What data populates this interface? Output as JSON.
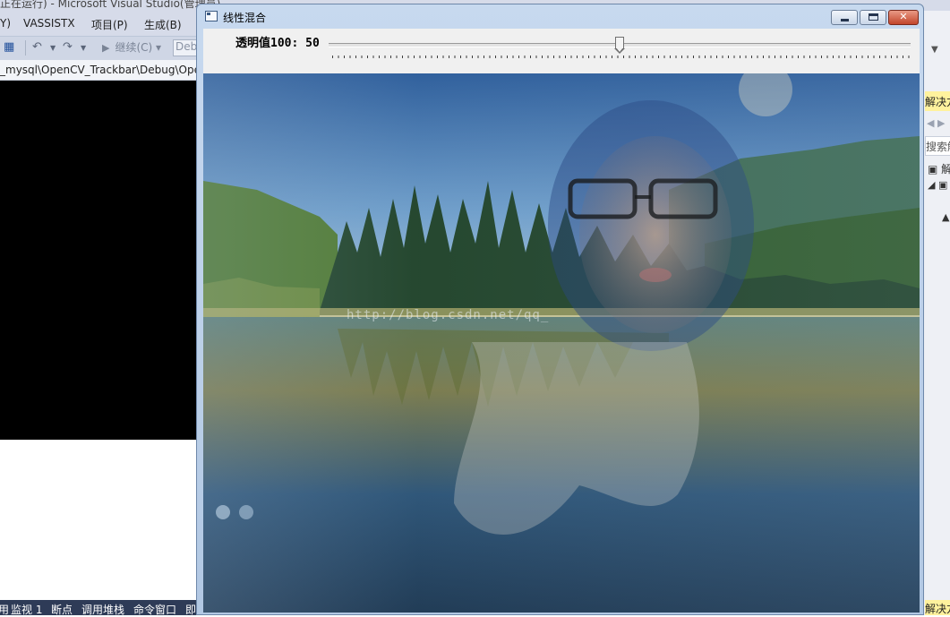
{
  "vs": {
    "title": "正在运行) - Microsoft Visual Studio(管理员)",
    "menu": [
      {
        "label": "Y)"
      },
      {
        "label": "VASSISTX"
      },
      {
        "label": "项目(P)"
      },
      {
        "label": "生成(B)"
      }
    ],
    "toolbar": {
      "continue_label": "继续(C)",
      "config_label": "Debug"
    },
    "path": "_mysql\\OpenCV_Trackbar\\Debug\\OpenCV_Trackbar.exe",
    "status_tabs": [
      "调用",
      "监视 1",
      "断点",
      "调用堆栈",
      "命令窗口",
      "即时窗口"
    ],
    "solution_explorer": {
      "header": "解决方案资源管理器",
      "search_placeholder": "搜索解决方案资源管理器",
      "footer": "解决方案资源管理器"
    },
    "icons": {
      "save": "save-icon",
      "undo": "undo-icon",
      "redo": "redo-icon",
      "play": "play-icon"
    }
  },
  "window": {
    "title": "线性混合",
    "trackbar": {
      "label": "透明值100: 50",
      "value": 50,
      "max": 100
    },
    "image": {
      "watermark": "http://blog.csdn.net/qq_"
    },
    "buttons": {
      "minimize": "minimize",
      "maximize": "maximize",
      "close": "close"
    },
    "colors": {
      "close_button": "#c2452b",
      "frame": "#b2c8e3"
    }
  }
}
